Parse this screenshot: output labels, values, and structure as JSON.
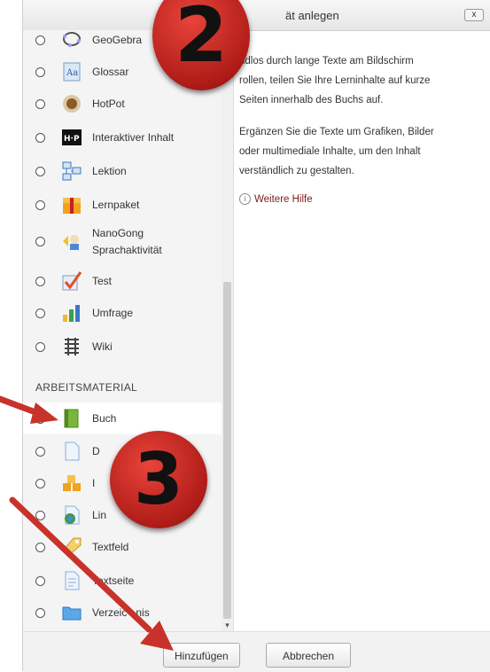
{
  "dialog": {
    "title": "ät anlegen",
    "close_label": "x"
  },
  "activities": [
    {
      "label": "GeoGebra",
      "icon": "geogebra-icon"
    },
    {
      "label": "Glossar",
      "icon": "glossary-icon"
    },
    {
      "label": "HotPot",
      "icon": "hotpot-icon"
    },
    {
      "label": "Interaktiver Inhalt",
      "icon": "h5p-icon"
    },
    {
      "label": "Lektion",
      "icon": "lesson-icon"
    },
    {
      "label": "Lernpaket",
      "icon": "package-icon"
    },
    {
      "label": "NanoGong",
      "label2": "Sprachaktivität",
      "icon": "nanogong-icon"
    },
    {
      "label": "Test",
      "icon": "quiz-icon"
    },
    {
      "label": "Umfrage",
      "icon": "survey-icon"
    },
    {
      "label": "Wiki",
      "icon": "wiki-icon"
    }
  ],
  "section_heading": "ARBEITSMATERIAL",
  "resources": [
    {
      "label": "Buch",
      "icon": "book-icon",
      "selected": true
    },
    {
      "label": "D",
      "icon": "file-icon"
    },
    {
      "label": "I",
      "icon": "imscp-icon"
    },
    {
      "label": "Lin",
      "icon": "url-icon"
    },
    {
      "label": "Textfeld",
      "icon": "label-icon"
    },
    {
      "label": "Textseite",
      "icon": "page-icon"
    },
    {
      "label": "Verzeic",
      "label_tail": "nis",
      "icon": "folder-icon"
    }
  ],
  "description": {
    "line1": "ndlos durch lange Texte am Bildschirm",
    "line2": "rollen, teilen Sie Ihre Lerninhalte auf kurze",
    "line3": "Seiten innerhalb des Buchs auf.",
    "line4": "Ergänzen Sie die Texte um Grafiken, Bilder",
    "line5": "oder multimediale Inhalte, um den Inhalt",
    "line6": "verständlich zu gestalten."
  },
  "help_link": "Weitere Hilfe",
  "footer": {
    "add_label": "Hinzufügen",
    "cancel_label": "Abbrechen"
  },
  "annotations": {
    "step2": "2",
    "step3": "3"
  }
}
